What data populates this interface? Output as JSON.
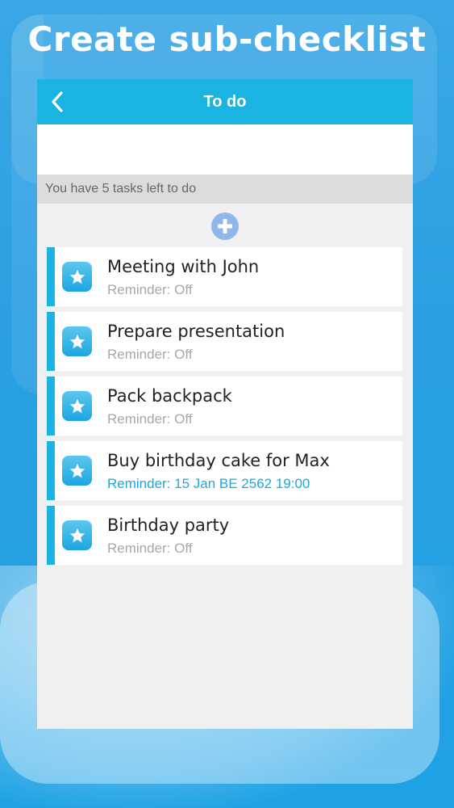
{
  "headline": "Create sub-checklist",
  "navbar": {
    "title": "To do",
    "back_icon": "chevron-left-icon"
  },
  "status_text": "You have 5 tasks left to do",
  "add_icon": "plus-circle-icon",
  "colors": {
    "accent": "#1ab3e2",
    "reminder_on": "#1ca9de",
    "reminder_off": "#a9a9a9"
  },
  "tasks": [
    {
      "title": "Meeting with John",
      "reminder": "Reminder: Off",
      "reminder_on": false,
      "icon": "star-icon"
    },
    {
      "title": "Prepare presentation",
      "reminder": "Reminder: Off",
      "reminder_on": false,
      "icon": "star-icon"
    },
    {
      "title": "Pack backpack",
      "reminder": "Reminder: Off",
      "reminder_on": false,
      "icon": "star-icon"
    },
    {
      "title": "Buy birthday cake for Max",
      "reminder": "Reminder: 15 Jan BE 2562 19:00",
      "reminder_on": true,
      "icon": "star-icon"
    },
    {
      "title": "Birthday party",
      "reminder": "Reminder: Off",
      "reminder_on": false,
      "icon": "star-icon"
    }
  ]
}
